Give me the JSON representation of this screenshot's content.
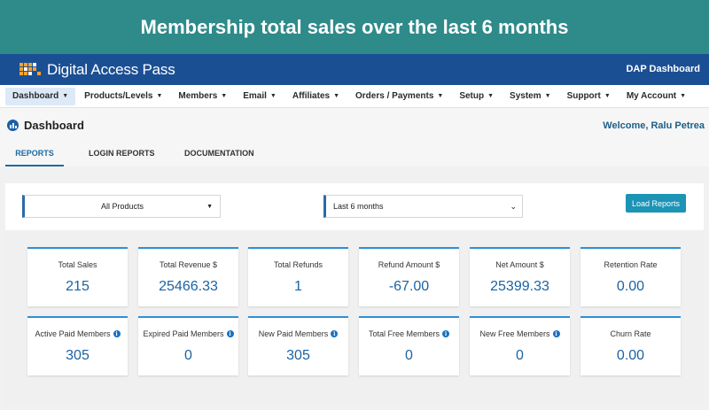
{
  "banner": {
    "title": "Membership total sales over the last 6 months"
  },
  "header": {
    "logo_text": "Digital Access Pass",
    "dashboard_link": "DAP Dashboard"
  },
  "nav": {
    "items": [
      {
        "label": "Dashboard"
      },
      {
        "label": "Products/Levels"
      },
      {
        "label": "Members"
      },
      {
        "label": "Email"
      },
      {
        "label": "Affiliates"
      },
      {
        "label": "Orders / Payments"
      },
      {
        "label": "Setup"
      },
      {
        "label": "System"
      },
      {
        "label": "Support"
      },
      {
        "label": "My Account"
      }
    ]
  },
  "page": {
    "title": "Dashboard",
    "welcome": "Welcome, Ralu Petrea",
    "tabs": [
      {
        "label": "REPORTS"
      },
      {
        "label": "LOGIN REPORTS"
      },
      {
        "label": "DOCUMENTATION"
      }
    ]
  },
  "filters": {
    "product_select": "All Products",
    "range_select": "Last 6 months",
    "load_button": "Load Reports"
  },
  "stats": [
    {
      "label": "Total Sales",
      "value": "215"
    },
    {
      "label": "Total Revenue $",
      "value": "25466.33"
    },
    {
      "label": "Total Refunds",
      "value": "1"
    },
    {
      "label": "Refund Amount $",
      "value": "-67.00"
    },
    {
      "label": "Net Amount $",
      "value": "25399.33"
    },
    {
      "label": "Retention Rate",
      "value": "0.00"
    },
    {
      "label": "Active Paid Members",
      "value": "305"
    },
    {
      "label": "Expired Paid Members",
      "value": "0"
    },
    {
      "label": "New Paid Members",
      "value": "305"
    },
    {
      "label": "Total Free Members",
      "value": "0"
    },
    {
      "label": "New Free Members",
      "value": "0"
    },
    {
      "label": "Churn Rate",
      "value": "0.00"
    }
  ],
  "info_glyph": "i",
  "colors": {
    "banner": "#2f8a8a",
    "header": "#1b4f93",
    "accent": "#1b63a3",
    "button": "#1b94b6"
  }
}
